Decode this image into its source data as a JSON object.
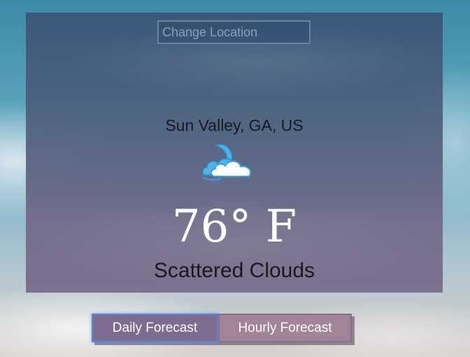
{
  "search": {
    "placeholder": "Change Location",
    "value": ""
  },
  "current": {
    "location": "Sun Valley, GA, US",
    "icon": "scattered-clouds-night-icon",
    "temperature": "76° F",
    "description": "Scattered Clouds"
  },
  "buttons": {
    "daily_label": "Daily Forecast",
    "hourly_label": "Hourly Forecast"
  },
  "colors": {
    "panel": "#566583",
    "active_button_border": "#5a86d6"
  }
}
